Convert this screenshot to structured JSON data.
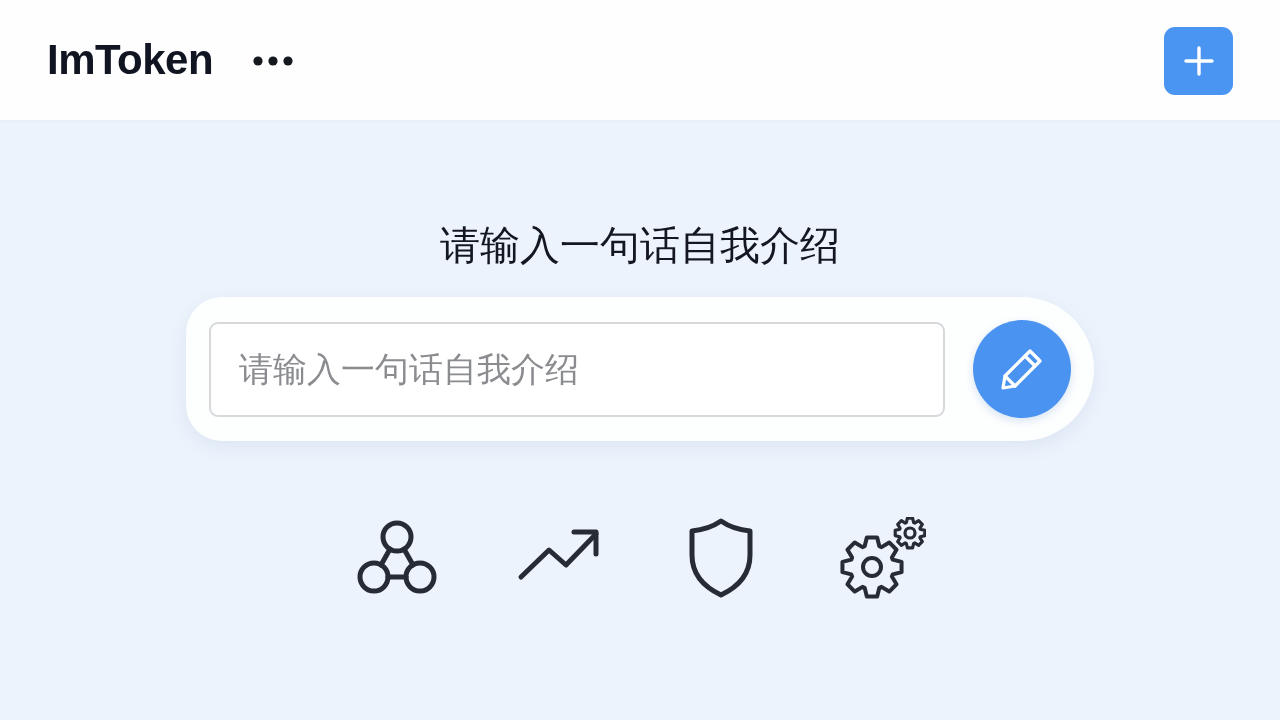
{
  "header": {
    "title": "ImToken"
  },
  "prompt": {
    "heading": "请输入一句话自我介绍",
    "input": {
      "placeholder": "请输入一句话自我介绍"
    }
  },
  "features": [
    {
      "kind": "network"
    },
    {
      "kind": "trend"
    },
    {
      "kind": "shield"
    },
    {
      "kind": "gears"
    }
  ]
}
